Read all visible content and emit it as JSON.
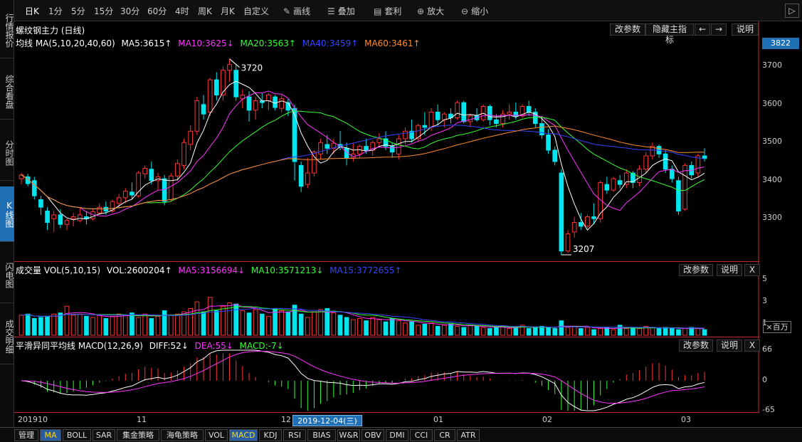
{
  "left_tabs": [
    {
      "label": "行情报价",
      "active": false
    },
    {
      "label": "综合看盘",
      "active": false
    },
    {
      "label": "分时图",
      "active": false
    },
    {
      "label": "K线图",
      "active": true
    },
    {
      "label": "闪电图",
      "active": false
    },
    {
      "label": "成交明细",
      "active": false
    }
  ],
  "toolbar": {
    "periods": [
      "日K",
      "1分",
      "5分",
      "15分",
      "30分",
      "60分",
      "4时",
      "周K",
      "月K",
      "自定义"
    ],
    "active_period": "日K",
    "draw_line": "画线",
    "overlay": "叠加",
    "arbitrage": "套利",
    "zoom_in": "放大",
    "zoom_out": "缩小",
    "collapse": "▷"
  },
  "main": {
    "title": "螺纹钢主力 (日线)",
    "buttons": [
      "改参数",
      "隐藏主指标",
      "←",
      "→",
      "说明"
    ],
    "ma_label": "均线 MA(5,10,20,40,60)",
    "ma_values": [
      {
        "text": "MA5:3615↑",
        "color": "#ffffff"
      },
      {
        "text": "MA10:3625↓",
        "color": "#ff33ff"
      },
      {
        "text": "MA20:3563↑",
        "color": "#33ff33"
      },
      {
        "text": "MA40:3459↑",
        "color": "#3344ff"
      },
      {
        "text": "MA60:3461↑",
        "color": "#ff8c2a"
      }
    ],
    "current_price": "3822",
    "y_ticks": [
      "3700",
      "3600",
      "3500",
      "3400",
      "3300"
    ],
    "high_label": "3720",
    "low_label": "3207"
  },
  "volume": {
    "label": "成交量 VOL(5,10,15)",
    "vol_value": "VOL:2600204↑",
    "ma_values": [
      {
        "text": "MA5:3156694↓",
        "color": "#ff33ff"
      },
      {
        "text": "MA10:3571213↓",
        "color": "#33ff33"
      },
      {
        "text": "MA15:3772655↑",
        "color": "#3344ff"
      }
    ],
    "buttons": [
      "改参数",
      "说明",
      "X"
    ],
    "y_ticks": [
      "5",
      "3",
      "1"
    ],
    "unit": "×百万"
  },
  "macd": {
    "label": "平滑异同平均线 MACD(12,26,9)",
    "diff": "DIFF:52↓",
    "dea": "DEA:55↓",
    "macd": "MACD:-7↓",
    "buttons": [
      "改参数",
      "说明",
      "X"
    ],
    "y_ticks": [
      "66",
      "0",
      "-65"
    ]
  },
  "x_axis": {
    "labels": [
      "201910",
      "11",
      "12",
      "01",
      "02",
      "03"
    ],
    "cursor_date": "2019-12-04(三)"
  },
  "bottom_tabs": [
    "管理",
    "MA",
    "BOLL",
    "SAR",
    "集金策略",
    "海龟策略",
    "VOL",
    "MACD",
    "KDJ",
    "RSI",
    "BIAS",
    "W&R",
    "OBV",
    "DMI",
    "CCI",
    "CR",
    "ATR"
  ],
  "bottom_active": [
    "MA",
    "MACD"
  ],
  "colors": {
    "up": "#ff3333",
    "down": "#00e5ee",
    "ma5": "#ffffff",
    "ma10": "#ff33ff",
    "ma20": "#33ff33",
    "ma40": "#3344ff",
    "ma60": "#ff8c2a",
    "accent": "#1f6fb5"
  },
  "chart_data": {
    "type": "candlestick",
    "y_range": [
      3190,
      3740
    ],
    "candles": [
      {
        "o": 3405,
        "h": 3420,
        "l": 3390,
        "c": 3415
      },
      {
        "o": 3410,
        "h": 3418,
        "l": 3385,
        "c": 3392
      },
      {
        "o": 3400,
        "h": 3410,
        "l": 3350,
        "c": 3360
      },
      {
        "o": 3350,
        "h": 3360,
        "l": 3310,
        "c": 3330
      },
      {
        "o": 3320,
        "h": 3330,
        "l": 3270,
        "c": 3290
      },
      {
        "o": 3300,
        "h": 3320,
        "l": 3265,
        "c": 3310
      },
      {
        "o": 3310,
        "h": 3325,
        "l": 3275,
        "c": 3285
      },
      {
        "o": 3285,
        "h": 3300,
        "l": 3270,
        "c": 3295
      },
      {
        "o": 3300,
        "h": 3315,
        "l": 3280,
        "c": 3305
      },
      {
        "o": 3295,
        "h": 3330,
        "l": 3290,
        "c": 3310
      },
      {
        "o": 3305,
        "h": 3320,
        "l": 3285,
        "c": 3300
      },
      {
        "o": 3300,
        "h": 3325,
        "l": 3295,
        "c": 3318
      },
      {
        "o": 3315,
        "h": 3340,
        "l": 3310,
        "c": 3330
      },
      {
        "o": 3330,
        "h": 3345,
        "l": 3310,
        "c": 3320
      },
      {
        "o": 3320,
        "h": 3350,
        "l": 3315,
        "c": 3345
      },
      {
        "o": 3340,
        "h": 3365,
        "l": 3330,
        "c": 3355
      },
      {
        "o": 3355,
        "h": 3380,
        "l": 3340,
        "c": 3372
      },
      {
        "o": 3370,
        "h": 3395,
        "l": 3350,
        "c": 3362
      },
      {
        "o": 3360,
        "h": 3425,
        "l": 3355,
        "c": 3420
      },
      {
        "o": 3418,
        "h": 3440,
        "l": 3405,
        "c": 3432
      },
      {
        "o": 3430,
        "h": 3450,
        "l": 3390,
        "c": 3400
      },
      {
        "o": 3400,
        "h": 3420,
        "l": 3375,
        "c": 3410
      },
      {
        "o": 3405,
        "h": 3415,
        "l": 3335,
        "c": 3345
      },
      {
        "o": 3350,
        "h": 3420,
        "l": 3345,
        "c": 3412
      },
      {
        "o": 3412,
        "h": 3455,
        "l": 3400,
        "c": 3445
      },
      {
        "o": 3440,
        "h": 3510,
        "l": 3430,
        "c": 3500
      },
      {
        "o": 3495,
        "h": 3545,
        "l": 3480,
        "c": 3530
      },
      {
        "o": 3530,
        "h": 3620,
        "l": 3520,
        "c": 3610
      },
      {
        "o": 3600,
        "h": 3625,
        "l": 3560,
        "c": 3575
      },
      {
        "o": 3580,
        "h": 3670,
        "l": 3570,
        "c": 3665
      },
      {
        "o": 3665,
        "h": 3685,
        "l": 3610,
        "c": 3625
      },
      {
        "o": 3625,
        "h": 3700,
        "l": 3610,
        "c": 3690
      },
      {
        "o": 3690,
        "h": 3720,
        "l": 3660,
        "c": 3705
      },
      {
        "o": 3690,
        "h": 3705,
        "l": 3610,
        "c": 3620
      },
      {
        "o": 3615,
        "h": 3640,
        "l": 3590,
        "c": 3625
      },
      {
        "o": 3620,
        "h": 3635,
        "l": 3555,
        "c": 3585
      },
      {
        "o": 3585,
        "h": 3620,
        "l": 3560,
        "c": 3610
      },
      {
        "o": 3610,
        "h": 3630,
        "l": 3590,
        "c": 3605
      },
      {
        "o": 3610,
        "h": 3630,
        "l": 3585,
        "c": 3625
      },
      {
        "o": 3620,
        "h": 3625,
        "l": 3585,
        "c": 3592
      },
      {
        "o": 3590,
        "h": 3625,
        "l": 3580,
        "c": 3615
      },
      {
        "o": 3605,
        "h": 3615,
        "l": 3570,
        "c": 3585
      },
      {
        "o": 3590,
        "h": 3600,
        "l": 3400,
        "c": 3450
      },
      {
        "o": 3440,
        "h": 3450,
        "l": 3370,
        "c": 3385
      },
      {
        "o": 3390,
        "h": 3460,
        "l": 3380,
        "c": 3420
      },
      {
        "o": 3420,
        "h": 3480,
        "l": 3410,
        "c": 3475
      },
      {
        "o": 3470,
        "h": 3510,
        "l": 3455,
        "c": 3500
      },
      {
        "o": 3495,
        "h": 3520,
        "l": 3470,
        "c": 3485
      },
      {
        "o": 3485,
        "h": 3510,
        "l": 3470,
        "c": 3498
      },
      {
        "o": 3495,
        "h": 3530,
        "l": 3480,
        "c": 3488
      },
      {
        "o": 3485,
        "h": 3500,
        "l": 3440,
        "c": 3460
      },
      {
        "o": 3460,
        "h": 3500,
        "l": 3450,
        "c": 3470
      },
      {
        "o": 3470,
        "h": 3495,
        "l": 3460,
        "c": 3490
      },
      {
        "o": 3490,
        "h": 3510,
        "l": 3470,
        "c": 3480
      },
      {
        "o": 3480,
        "h": 3505,
        "l": 3465,
        "c": 3500
      },
      {
        "o": 3500,
        "h": 3525,
        "l": 3490,
        "c": 3510
      },
      {
        "o": 3510,
        "h": 3530,
        "l": 3480,
        "c": 3490
      },
      {
        "o": 3490,
        "h": 3500,
        "l": 3460,
        "c": 3475
      },
      {
        "o": 3470,
        "h": 3520,
        "l": 3455,
        "c": 3510
      },
      {
        "o": 3510,
        "h": 3540,
        "l": 3495,
        "c": 3530
      },
      {
        "o": 3530,
        "h": 3560,
        "l": 3500,
        "c": 3510
      },
      {
        "o": 3510,
        "h": 3550,
        "l": 3500,
        "c": 3545
      },
      {
        "o": 3545,
        "h": 3580,
        "l": 3520,
        "c": 3540
      },
      {
        "o": 3540,
        "h": 3590,
        "l": 3530,
        "c": 3580
      },
      {
        "o": 3580,
        "h": 3600,
        "l": 3545,
        "c": 3560
      },
      {
        "o": 3560,
        "h": 3580,
        "l": 3540,
        "c": 3575
      },
      {
        "o": 3575,
        "h": 3590,
        "l": 3550,
        "c": 3565
      },
      {
        "o": 3565,
        "h": 3610,
        "l": 3560,
        "c": 3605
      },
      {
        "o": 3605,
        "h": 3610,
        "l": 3550,
        "c": 3555
      },
      {
        "o": 3555,
        "h": 3575,
        "l": 3540,
        "c": 3570
      },
      {
        "o": 3570,
        "h": 3590,
        "l": 3555,
        "c": 3560
      },
      {
        "o": 3560,
        "h": 3600,
        "l": 3555,
        "c": 3595
      },
      {
        "o": 3595,
        "h": 3600,
        "l": 3545,
        "c": 3560
      },
      {
        "o": 3560,
        "h": 3575,
        "l": 3540,
        "c": 3550
      },
      {
        "o": 3550,
        "h": 3585,
        "l": 3540,
        "c": 3575
      },
      {
        "o": 3575,
        "h": 3600,
        "l": 3560,
        "c": 3580
      },
      {
        "o": 3580,
        "h": 3605,
        "l": 3560,
        "c": 3570
      },
      {
        "o": 3570,
        "h": 3600,
        "l": 3565,
        "c": 3595
      },
      {
        "o": 3595,
        "h": 3610,
        "l": 3570,
        "c": 3580
      },
      {
        "o": 3580,
        "h": 3590,
        "l": 3540,
        "c": 3550
      },
      {
        "o": 3550,
        "h": 3570,
        "l": 3510,
        "c": 3520
      },
      {
        "o": 3520,
        "h": 3535,
        "l": 3470,
        "c": 3480
      },
      {
        "o": 3480,
        "h": 3490,
        "l": 3440,
        "c": 3450
      },
      {
        "o": 3420,
        "h": 3430,
        "l": 3205,
        "c": 3215
      },
      {
        "o": 3215,
        "h": 3270,
        "l": 3210,
        "c": 3260
      },
      {
        "o": 3265,
        "h": 3305,
        "l": 3250,
        "c": 3290
      },
      {
        "o": 3290,
        "h": 3315,
        "l": 3270,
        "c": 3280
      },
      {
        "o": 3280,
        "h": 3310,
        "l": 3275,
        "c": 3305
      },
      {
        "o": 3305,
        "h": 3340,
        "l": 3285,
        "c": 3300
      },
      {
        "o": 3300,
        "h": 3400,
        "l": 3290,
        "c": 3395
      },
      {
        "o": 3390,
        "h": 3410,
        "l": 3365,
        "c": 3375
      },
      {
        "o": 3375,
        "h": 3410,
        "l": 3370,
        "c": 3405
      },
      {
        "o": 3400,
        "h": 3415,
        "l": 3380,
        "c": 3390
      },
      {
        "o": 3390,
        "h": 3430,
        "l": 3380,
        "c": 3420
      },
      {
        "o": 3420,
        "h": 3425,
        "l": 3380,
        "c": 3395
      },
      {
        "o": 3395,
        "h": 3440,
        "l": 3385,
        "c": 3430
      },
      {
        "o": 3430,
        "h": 3475,
        "l": 3420,
        "c": 3465
      },
      {
        "o": 3465,
        "h": 3500,
        "l": 3455,
        "c": 3490
      },
      {
        "o": 3490,
        "h": 3495,
        "l": 3460,
        "c": 3470
      },
      {
        "o": 3470,
        "h": 3480,
        "l": 3420,
        "c": 3430
      },
      {
        "o": 3430,
        "h": 3440,
        "l": 3395,
        "c": 3405
      },
      {
        "o": 3400,
        "h": 3410,
        "l": 3310,
        "c": 3320
      },
      {
        "o": 3325,
        "h": 3445,
        "l": 3320,
        "c": 3440
      },
      {
        "o": 3440,
        "h": 3450,
        "l": 3405,
        "c": 3415
      },
      {
        "o": 3420,
        "h": 3470,
        "l": 3410,
        "c": 3465
      },
      {
        "o": 3465,
        "h": 3485,
        "l": 3450,
        "c": 3458
      }
    ],
    "volume": [
      1.8,
      1.9,
      1.5,
      1.6,
      1.7,
      1.9,
      2.0,
      2.6,
      1.8,
      1.9,
      1.7,
      1.6,
      1.8,
      1.5,
      1.7,
      1.9,
      1.8,
      2.0,
      1.6,
      1.9,
      1.5,
      1.7,
      2.2,
      1.8,
      1.9,
      2.1,
      2.4,
      3.0,
      2.1,
      3.4,
      2.2,
      2.6,
      2.9,
      2.8,
      2.2,
      2.0,
      2.3,
      1.9,
      1.7,
      2.4,
      2.2,
      2.1,
      2.7,
      1.9,
      1.6,
      2.1,
      2.3,
      2.4,
      2.0,
      1.8,
      1.6,
      1.4,
      1.5,
      1.3,
      1.6,
      1.4,
      1.2,
      1.5,
      1.3,
      1.1,
      1.2,
      0.9,
      1.0,
      1.1,
      0.8,
      0.9,
      1.0,
      0.8,
      0.7,
      0.9,
      0.8,
      0.7,
      0.6,
      0.7,
      0.8,
      0.6,
      0.7,
      0.9,
      0.6,
      0.7,
      0.8,
      0.7,
      0.6,
      1.3,
      0.7,
      0.8,
      0.6,
      0.7,
      0.5,
      0.6,
      0.7,
      0.5,
      0.9,
      0.6,
      0.7,
      0.6,
      0.8,
      0.7,
      0.6,
      0.7,
      0.6,
      0.5,
      0.6,
      0.7,
      0.6,
      0.5
    ]
  }
}
